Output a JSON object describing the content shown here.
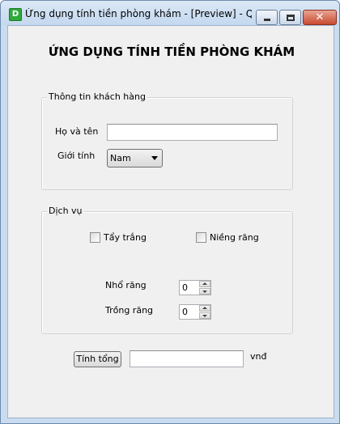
{
  "window": {
    "app_icon_letter": "D",
    "title": "Ứng dụng tính tiền phòng khám - [Preview] - Qt D...",
    "close_glyph": "✕"
  },
  "heading": "ỨNG DỤNG TÍNH TIỀN PHÒNG KHÁM",
  "customer": {
    "group_title": "Thông tin khách hàng",
    "name_label": "Họ và tên",
    "name_value": "",
    "gender_label": "Giới tính",
    "gender_value": "Nam"
  },
  "services": {
    "group_title": "Dịch vụ",
    "whitening_label": "Tẩy trắng",
    "whitening_checked": false,
    "braces_label": "Niềng răng",
    "braces_checked": false,
    "extraction_label": "Nhổ răng",
    "extraction_count": "0",
    "implant_label": "Trồng răng",
    "implant_count": "0"
  },
  "total": {
    "button_label": "Tính tổng",
    "value": "",
    "unit": "vnđ"
  },
  "colors": {
    "titlebar": "#c4d8ef",
    "client_bg": "#f0f0f0",
    "close_button": "#c94a32"
  }
}
